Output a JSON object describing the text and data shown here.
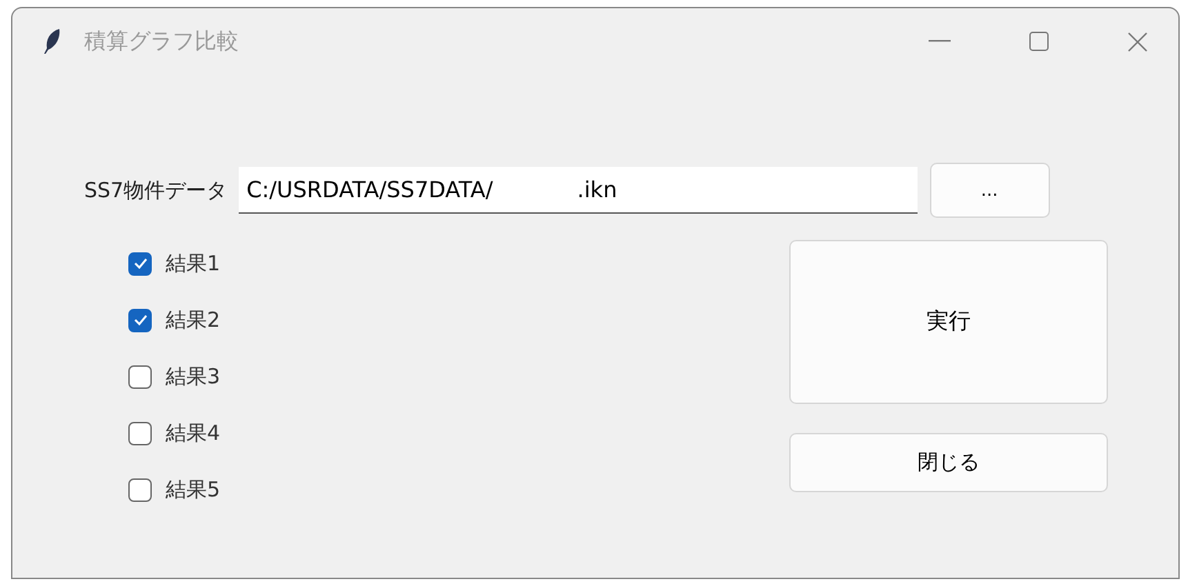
{
  "window": {
    "title": "積算グラフ比較"
  },
  "file": {
    "label": "SS7物件データ",
    "value": "C:/USRDATA/SS7DATA/            .ikn",
    "browse": "..."
  },
  "results": [
    {
      "label": "結果1",
      "checked": true
    },
    {
      "label": "結果2",
      "checked": true
    },
    {
      "label": "結果3",
      "checked": false
    },
    {
      "label": "結果4",
      "checked": false
    },
    {
      "label": "結果5",
      "checked": false
    }
  ],
  "buttons": {
    "run": "実行",
    "close": "閉じる"
  }
}
